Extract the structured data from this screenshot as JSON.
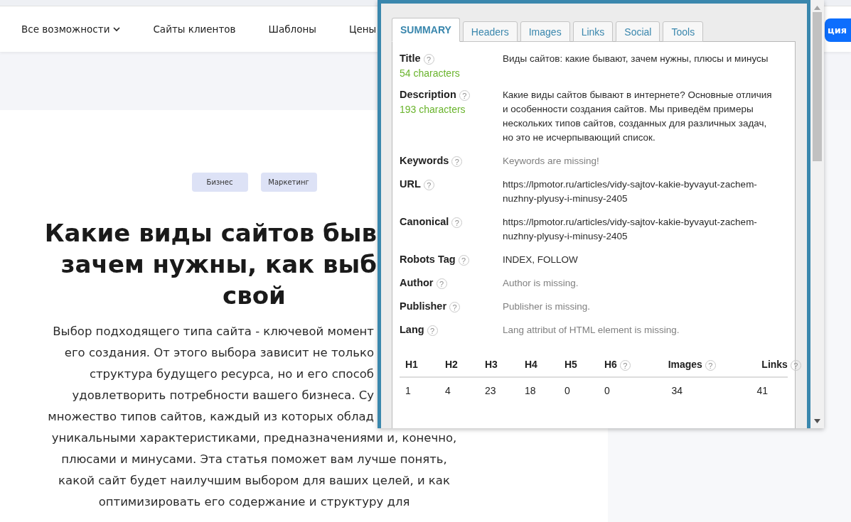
{
  "nav": {
    "items": [
      {
        "label": "Все возможности",
        "dropdown": true
      },
      {
        "label": "Сайты клиентов",
        "dropdown": false
      },
      {
        "label": "Шаблоны",
        "dropdown": false
      },
      {
        "label": "Цены",
        "dropdown": false
      }
    ],
    "button": "ция"
  },
  "article": {
    "tags": [
      "Бизнес",
      "Маркетинг"
    ],
    "title_lines": [
      {
        "text": "Какие виды сайтов быв",
        "kind": "clipped"
      },
      {
        "text": "зачем нужны, как выб",
        "kind": "clipped"
      },
      {
        "text": "свой",
        "kind": "full"
      }
    ],
    "lines": [
      {
        "text": "Выбор подходящего типа сайта - ключевой момент",
        "kind": "clipped"
      },
      {
        "text": "его создания. От этого выбора зависит не только",
        "kind": "clipped"
      },
      {
        "text": "структура будущего ресурса, но и его способ",
        "kind": "clipped"
      },
      {
        "text": "удовлетворить потребности вашего бизнеса. Су",
        "kind": "clipped"
      },
      {
        "text": "множество типов сайтов, каждый из которых облад",
        "kind": "clipped"
      },
      {
        "text": "уникальными характеристиками, предназначениями и, конечно,",
        "kind": "full"
      },
      {
        "text": "плюсами и минусами. Эта статья поможет вам лучше понять,",
        "kind": "full"
      },
      {
        "text": "какой сайт будет наилучшим выбором для ваших целей, и как",
        "kind": "full"
      },
      {
        "text": "оптимизировать его содержание и структуру для",
        "kind": "full"
      }
    ]
  },
  "popup": {
    "tabs": [
      {
        "label": "SUMMARY",
        "selected": true
      },
      {
        "label": "Headers",
        "selected": false
      },
      {
        "label": "Images",
        "selected": false
      },
      {
        "label": "Links",
        "selected": false
      },
      {
        "label": "Social",
        "selected": false
      },
      {
        "label": "Tools",
        "selected": false
      }
    ],
    "rows": [
      {
        "label": "Title",
        "help": "?",
        "count": "54 characters",
        "value": "Виды сайтов: какие бывают, зачем нужны, плюсы и минусы",
        "missing": false
      },
      {
        "label": "Description",
        "help": "?",
        "count": "193 characters",
        "value": "Какие виды сайтов бывают в интернете? Основные отличия и особенности создания сайтов. Мы приведём примеры нескольких типов сайтов, созданных для различных задач, но это не исчерпывающий список.",
        "missing": false
      },
      {
        "label": "Keywords",
        "help": "?",
        "value": "Keywords are missing!",
        "missing": true
      },
      {
        "label": "URL",
        "help": "?",
        "value": "https://lpmotor.ru/articles/vidy-sajtov-kakie-byvayut-zachem-nuzhny-plyusy-i-minusy-2405",
        "missing": false
      },
      {
        "label": "Canonical",
        "help": "?",
        "value": "https://lpmotor.ru/articles/vidy-sajtov-kakie-byvayut-zachem-nuzhny-plyusy-i-minusy-2405",
        "missing": false
      },
      {
        "label": "Robots Tag",
        "help": "?",
        "value": "INDEX, FOLLOW",
        "missing": false
      },
      {
        "label": "Author",
        "help": "?",
        "value": "Author is missing.",
        "missing": true
      },
      {
        "label": "Publisher",
        "help": "?",
        "value": "Publisher is missing.",
        "missing": true
      },
      {
        "label": "Lang",
        "help": "?",
        "value": "Lang attribut of HTML element is missing.",
        "missing": true
      }
    ],
    "stats": {
      "columns": [
        {
          "label": "H1",
          "value": "1",
          "kind": "heading"
        },
        {
          "label": "H2",
          "value": "4",
          "kind": "heading"
        },
        {
          "label": "H3",
          "value": "23",
          "kind": "heading"
        },
        {
          "label": "H4",
          "value": "18",
          "kind": "heading"
        },
        {
          "label": "H5",
          "value": "0",
          "kind": "heading"
        },
        {
          "label": "H6",
          "value": "0",
          "help": "?",
          "kind": "heading"
        },
        {
          "label": "Images",
          "value": "34",
          "help": "?",
          "kind": "count"
        },
        {
          "label": "Links",
          "value": "41",
          "help": "?",
          "kind": "count"
        }
      ]
    }
  }
}
